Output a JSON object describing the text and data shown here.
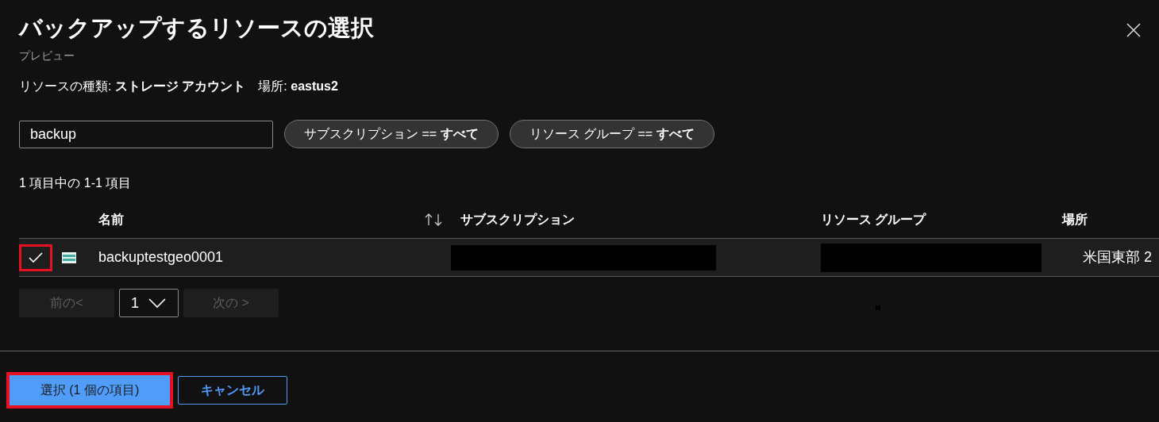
{
  "title": "バックアップするリソースの選択",
  "subtitle": "プレビュー",
  "info": [
    "リソースの種類: **ストレージ アカウント**",
    "場所: **eastus2**"
  ],
  "search": {
    "value": "backup"
  },
  "filters": [
    "サブスクリプション == **すべて**",
    "リソース グループ == **すべて**"
  ],
  "count": "1 項目中の 1-1 項目",
  "columns": [
    "名前",
    "サブスクリプション",
    "リソース グループ",
    "場所"
  ],
  "rows": [
    {
      "selected": true,
      "highlighted": true,
      "name": "backuptestgeo0001",
      "location": "米国東部 2"
    }
  ],
  "pagination": {
    "prev": "前の<",
    "prev_disabled": true,
    "page": "1",
    "next": "次の >",
    "next_disabled": true
  },
  "buttons": [
    {
      "label": "選択 (1 個の項目)",
      "kind": "primary",
      "highlighted": true
    },
    {
      "label": "キャンセル",
      "kind": "secondary",
      "highlighted": false
    }
  ]
}
